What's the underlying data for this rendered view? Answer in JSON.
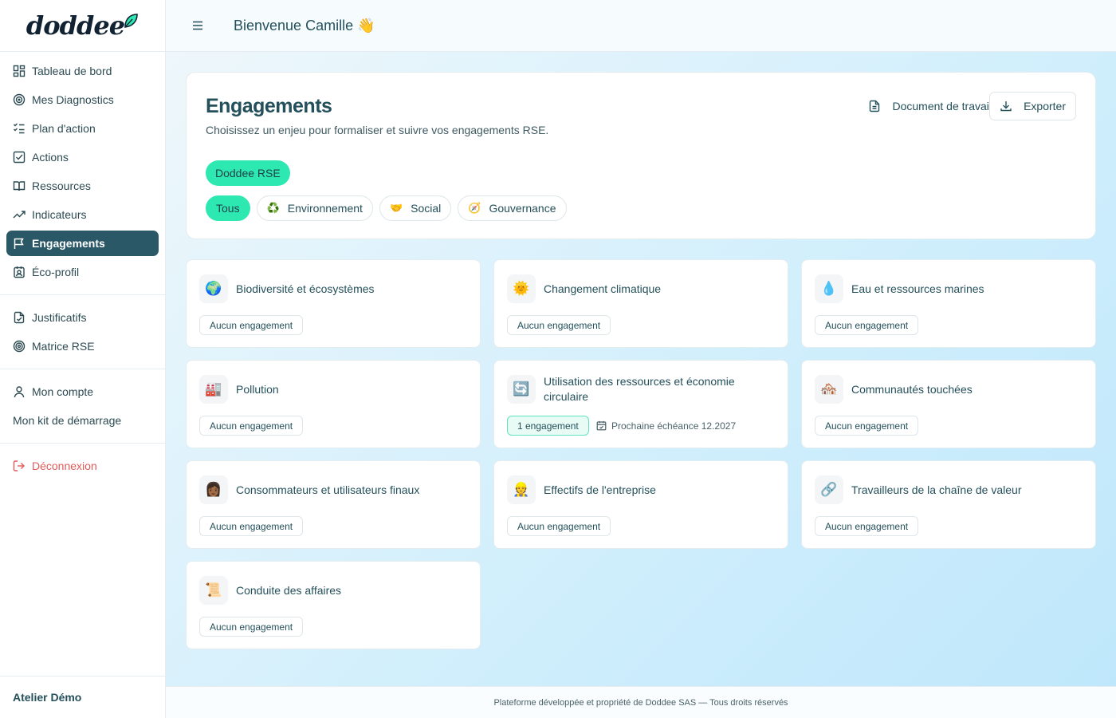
{
  "app": {
    "logo": "doddee"
  },
  "topbar": {
    "welcome": "Bienvenue Camille 👋"
  },
  "sidebar": {
    "items": [
      {
        "label": "Tableau de bord"
      },
      {
        "label": "Mes Diagnostics"
      },
      {
        "label": "Plan d'action"
      },
      {
        "label": "Actions"
      },
      {
        "label": "Ressources"
      },
      {
        "label": "Indicateurs"
      },
      {
        "label": "Engagements"
      },
      {
        "label": "Éco-profil"
      }
    ],
    "secondary": [
      {
        "label": "Justificatifs"
      },
      {
        "label": "Matrice RSE"
      }
    ],
    "account": [
      {
        "label": "Mon compte"
      },
      {
        "label": "Mon kit de démarrage"
      }
    ],
    "logout": "Déconnexion",
    "workspace": "Atelier Démo"
  },
  "page": {
    "title": "Engagements",
    "subtitle": "Choisissez un enjeu pour formaliser et suivre vos engagements RSE.",
    "doc_button": "Document de travail",
    "export_button": "Exporter",
    "framework_pill": "Doddee RSE",
    "filters": [
      {
        "label": "Tous",
        "emoji": ""
      },
      {
        "label": "Environnement",
        "emoji": "♻️"
      },
      {
        "label": "Social",
        "emoji": "🤝"
      },
      {
        "label": "Gouvernance",
        "emoji": "🧭"
      }
    ]
  },
  "cards": [
    {
      "emoji": "🌍",
      "title": "Biodiversité et écosystèmes",
      "badge": "Aucun engagement"
    },
    {
      "emoji": "🌞",
      "title": "Changement climatique",
      "badge": "Aucun engagement"
    },
    {
      "emoji": "💧",
      "title": "Eau et ressources marines",
      "badge": "Aucun engagement"
    },
    {
      "emoji": "🏭",
      "title": "Pollution",
      "badge": "Aucun engagement"
    },
    {
      "emoji": "🔄",
      "title": "Utilisation des ressources et économie circulaire",
      "badge": "1 engagement",
      "due": "Prochaine échéance 12.2027"
    },
    {
      "emoji": "🏘️",
      "title": "Communautés touchées",
      "badge": "Aucun engagement"
    },
    {
      "emoji": "👩🏾",
      "title": "Consommateurs et utilisateurs finaux",
      "badge": "Aucun engagement"
    },
    {
      "emoji": "👷",
      "title": "Effectifs de l'entreprise",
      "badge": "Aucun engagement"
    },
    {
      "emoji": "🔗",
      "title": "Travailleurs de la chaîne de valeur",
      "badge": "Aucun engagement"
    },
    {
      "emoji": "📜",
      "title": "Conduite des affaires",
      "badge": "Aucun engagement"
    }
  ],
  "footer": "Plateforme développée et propriété de Doddee SAS — Tous droits réservés",
  "colors": {
    "accent": "#2ee8b2",
    "active_nav": "#2b5866",
    "text": "#24505b",
    "danger": "#e25b5b"
  }
}
